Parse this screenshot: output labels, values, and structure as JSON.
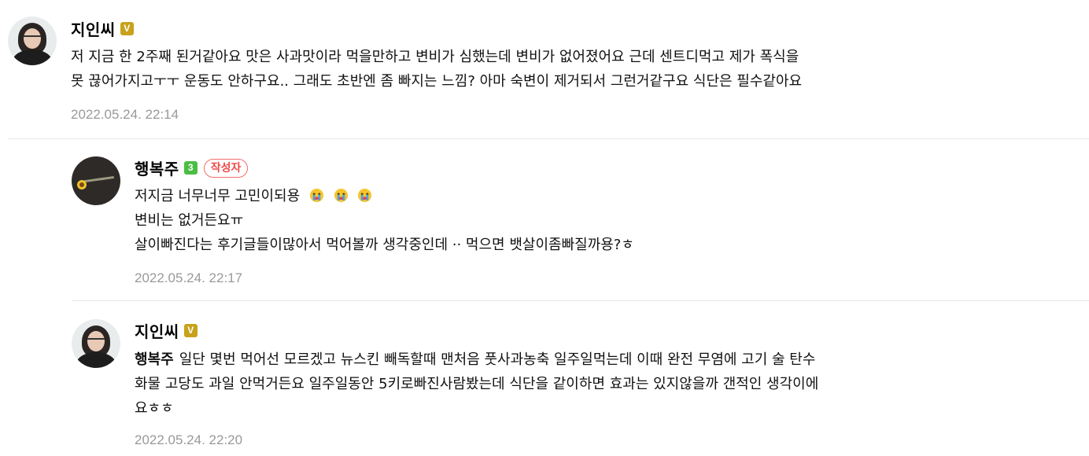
{
  "comments": [
    {
      "author": "지인씨",
      "level": "V",
      "lines": [
        "저 지금 한 2주째 된거같아요 맛은 사과맛이라 먹을만하고 변비가 심했는데 변비가 없어졌어요 근데 센트디먹고 제가 폭식을",
        "못 끊어가지고ㅜㅜ 운동도 안하구요.. 그래도 초반엔 좀 빠지는 느낌? 아마 숙변이 제거되서 그런거같구요 식단은 필수같아요"
      ],
      "time": "2022.05.24. 22:14"
    },
    {
      "author": "행복주",
      "level": "3",
      "author_tag": "작성자",
      "lines": [
        "저지금 너무너무 고민이되용",
        "변비는 없거든요ㅠ",
        "살이빠진다는 후기글들이많아서 먹어볼까 생각중인데 ·· 먹으면 뱃살이좀빠질까용?ㅎ"
      ],
      "emoji": [
        "crying-face",
        "crying-face",
        "crying-face"
      ],
      "time": "2022.05.24. 22:17"
    },
    {
      "author": "지인씨",
      "level": "V",
      "mention": "행복주",
      "lines": [
        "일단 몇번 먹어선 모르겠고 뉴스킨 빼독할때 맨처음 풋사과농축 일주일먹는데 이때 완전 무염에 고기 술 탄수",
        "화물 고당도 과일 안먹거든요 일주일동안 5키로빠진사람봤는데 식단을 같이하면 효과는 있지않을까 갠적인 생각이에",
        "요ㅎㅎ"
      ],
      "time": "2022.05.24. 22:20"
    }
  ],
  "colors": {
    "badge_v": "#c8a21c",
    "badge_level3": "#4cbd44",
    "author_tag": "#ef4a4a",
    "timestamp": "#999999",
    "divider": "#e8e8e8"
  }
}
